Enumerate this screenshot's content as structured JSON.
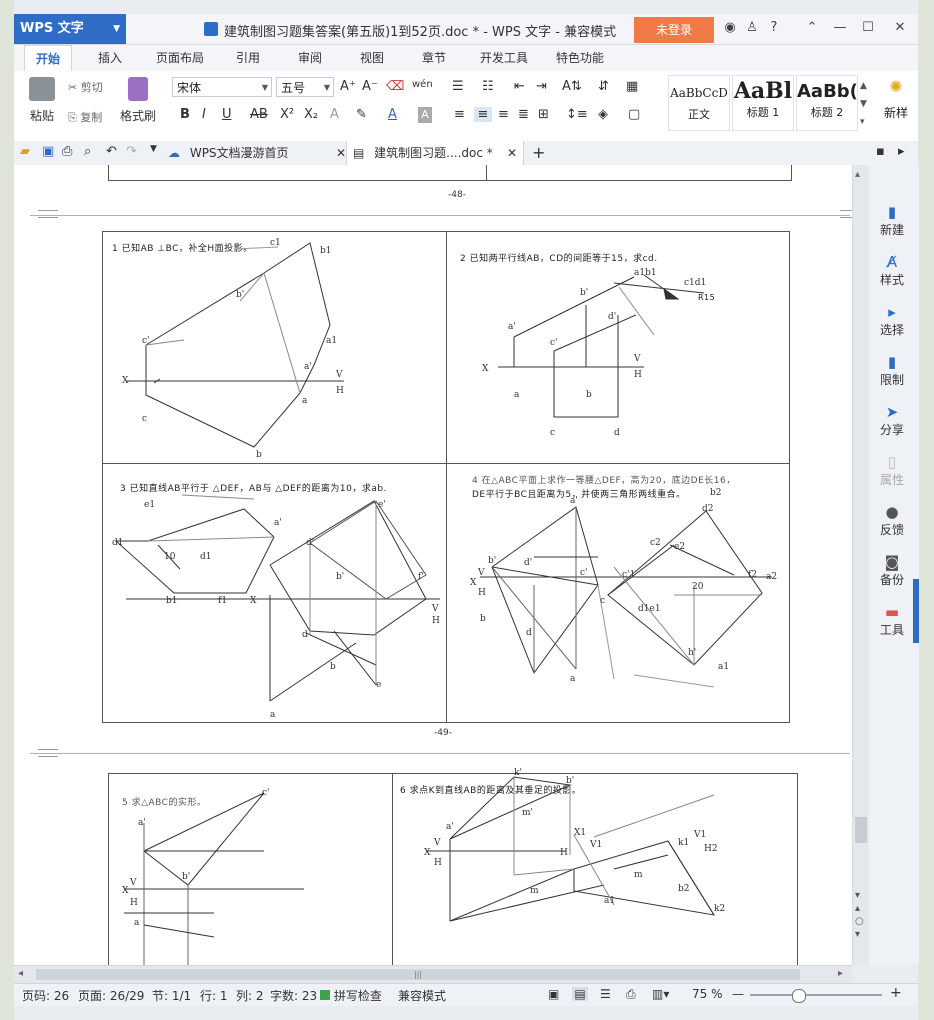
{
  "titlebar": {
    "app_button": "WPS 文字",
    "document_title": "建筑制图习题集答案(第五版)1到52页.doc * - WPS 文字 - 兼容模式",
    "login_button": "未登录",
    "help_label": "?"
  },
  "tabs": [
    "开始",
    "插入",
    "页面布局",
    "引用",
    "审阅",
    "视图",
    "章节",
    "开发工具",
    "特色功能"
  ],
  "ribbon": {
    "paste": "粘贴",
    "cut": "剪切",
    "copy": "复制",
    "format_painter": "格式刷",
    "font_name": "宋体",
    "font_size": "五号",
    "styles": [
      {
        "preview": "AaBbCcD",
        "name": "正文"
      },
      {
        "preview": "AaBl",
        "name": "标题 1"
      },
      {
        "preview": "AaBb(",
        "name": "标题 2"
      }
    ],
    "new_style": "新样"
  },
  "doctabs": {
    "home_tab": "WPS文档漫游首页",
    "doc_tab": "建筑制图习题....doc *"
  },
  "document": {
    "page48_num": "-48-",
    "page49_num": "-49-",
    "q1": "1 已知AB ⊥BC，补全H面投影。",
    "q2": "2 已知两平行线AB，CD的间距等于15，求cd.",
    "q2_r": "R15",
    "q3": "3 已知直线AB平行于 △DEF，AB与 △DEF的距离为10，求ab.",
    "q4_line1": "4 在△ABC平面上求作一等腰△DEF，高为20，底边DE长16，",
    "q4_line2": "DE平行于BC且距离为5，并使两三角形两线重合。",
    "q5": "5 求△ABC的实形。",
    "q6": "6 求点K到直线AB的距离及其垂足的投影。"
  },
  "right_panel": [
    "新建",
    "样式",
    "选择",
    "限制",
    "分享",
    "属性",
    "反馈",
    "备份",
    "工具"
  ],
  "status": {
    "page_code": "页码: 26",
    "page": "页面: 26/29",
    "section": "节: 1/1",
    "row": "行: 1",
    "col": "列: 2",
    "words": "字数: 23",
    "spell": "拼写检查",
    "compat": "兼容模式",
    "zoom": "75 %"
  },
  "colors": {
    "accent": "#2f6cc8",
    "login": "#f07b47"
  }
}
